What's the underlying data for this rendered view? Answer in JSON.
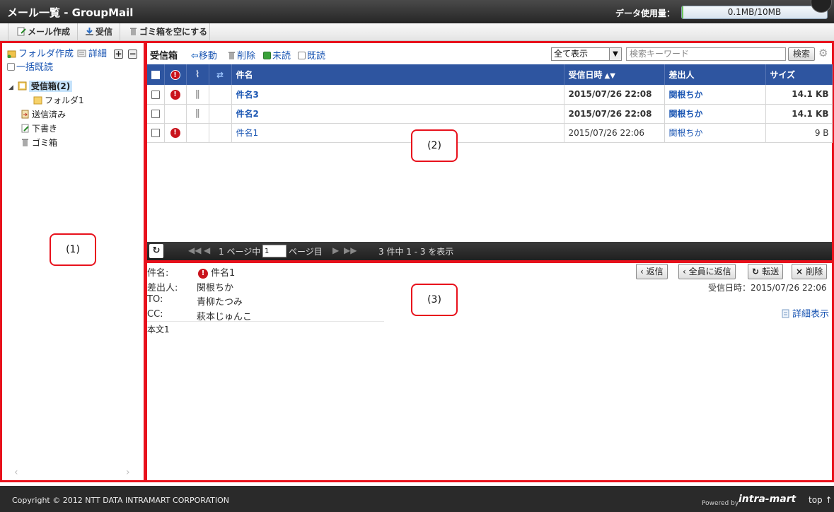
{
  "window": {
    "title": "メール一覧 - GroupMail"
  },
  "usage": {
    "label": "データ使用量：",
    "value": "0.1MB/10MB",
    "fraction": 0.01
  },
  "toolbar": {
    "compose": "メール作成",
    "receive": "受信",
    "empty_trash": "ゴミ箱を空にする"
  },
  "left": {
    "create_folder": "フォルダ作成",
    "details": "詳細",
    "bulk_read": "一括既読",
    "tree": [
      {
        "label": "受信箱(2)"
      },
      {
        "label": "フォルダ1"
      },
      {
        "label": "送信済み"
      },
      {
        "label": "下書き"
      },
      {
        "label": "ゴミ箱"
      }
    ]
  },
  "list": {
    "title": "受信箱",
    "move": "移動",
    "delete": "削除",
    "unread": "未読",
    "read": "既読",
    "filter": "全て表示",
    "search_placeholder": "検索キーワード",
    "search_button": "検索",
    "columns": {
      "subject": "件名",
      "received": "受信日時",
      "sender": "差出人",
      "size": "サイズ"
    },
    "rows": [
      {
        "subject": "件名3",
        "received": "2015/07/26 22:08",
        "sender": "関根ちか",
        "size": "14.1 KB"
      },
      {
        "subject": "件名2",
        "received": "2015/07/26 22:08",
        "sender": "関根ちか",
        "size": "14.1 KB"
      },
      {
        "subject": "件名1",
        "received": "2015/07/26 22:06",
        "sender": "関根ちか",
        "size": "9 B"
      }
    ],
    "pager": {
      "page_prefix": "1 ページ中",
      "page_value": "1",
      "page_suffix": "ページ目",
      "summary": "3 件中 1 - 3 を表示"
    }
  },
  "detail": {
    "subject_label": "件名:",
    "subject": "件名1",
    "from_label": "差出人:",
    "from": "関根ちか",
    "to_label": "TO:",
    "to": "青柳たつみ",
    "cc_label": "CC:",
    "cc": "萩本じゅんこ",
    "reply": "返信",
    "reply_all": "全員に返信",
    "forward": "転送",
    "delete": "削除",
    "received": "受信日時：2015/07/26 22:06",
    "show_details": "詳細表示",
    "body": "本文1"
  },
  "callouts": {
    "left": "(1)",
    "list": "(2)",
    "detail": "(3)"
  },
  "footer": {
    "copyright": "Copyright © 2012 NTT DATA INTRAMART CORPORATION",
    "powered": "Powered by",
    "brand": "intra-mart",
    "top": "top ↑"
  }
}
